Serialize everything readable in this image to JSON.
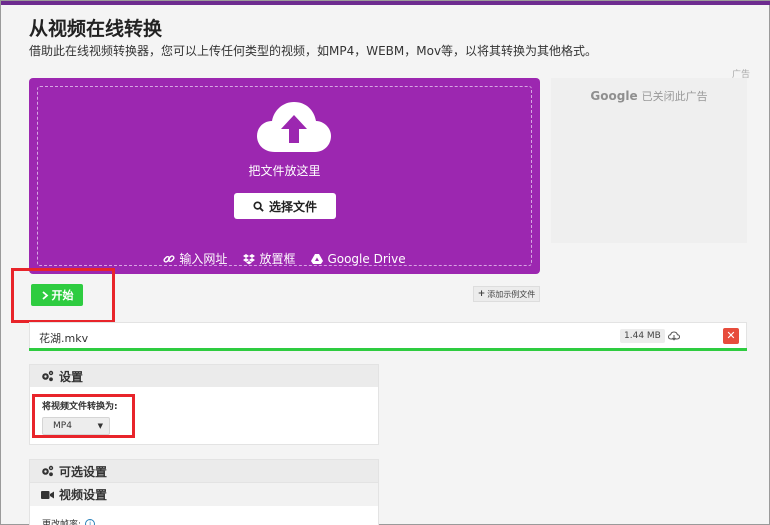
{
  "page": {
    "title": "从视频在线转换",
    "subtitle": "借助此在线视频转换器，您可以上传任何类型的视频，如MP4，WEBM，Mov等，以将其转换为其他格式。"
  },
  "colors": {
    "accent": "#9c27b0",
    "start": "#2ecc40",
    "delete": "#e74c3c",
    "highlight": "#e8242a"
  },
  "dropzone": {
    "drop_text": "把文件放这里",
    "choose_label": "选择文件",
    "sources": [
      {
        "label": "输入网址",
        "icon": "link-icon"
      },
      {
        "label": "放置框",
        "icon": "dropbox-icon"
      },
      {
        "label": "Google Drive",
        "icon": "google-drive-icon"
      }
    ]
  },
  "ad": {
    "label": "广告",
    "brand": "Google",
    "text": "已关闭此广告"
  },
  "actions": {
    "start_label": "开始",
    "sample_label": "添加示例文件"
  },
  "file": {
    "name": "花湖.mkv",
    "size": "1.44 MB",
    "progress": 1.0
  },
  "settings": {
    "header": "设置",
    "convert_label": "将视频文件转换为:",
    "format_value": "MP4"
  },
  "optional": {
    "header": "可选设置",
    "video_header": "视频设置",
    "cut_label": "更改帧率:"
  }
}
